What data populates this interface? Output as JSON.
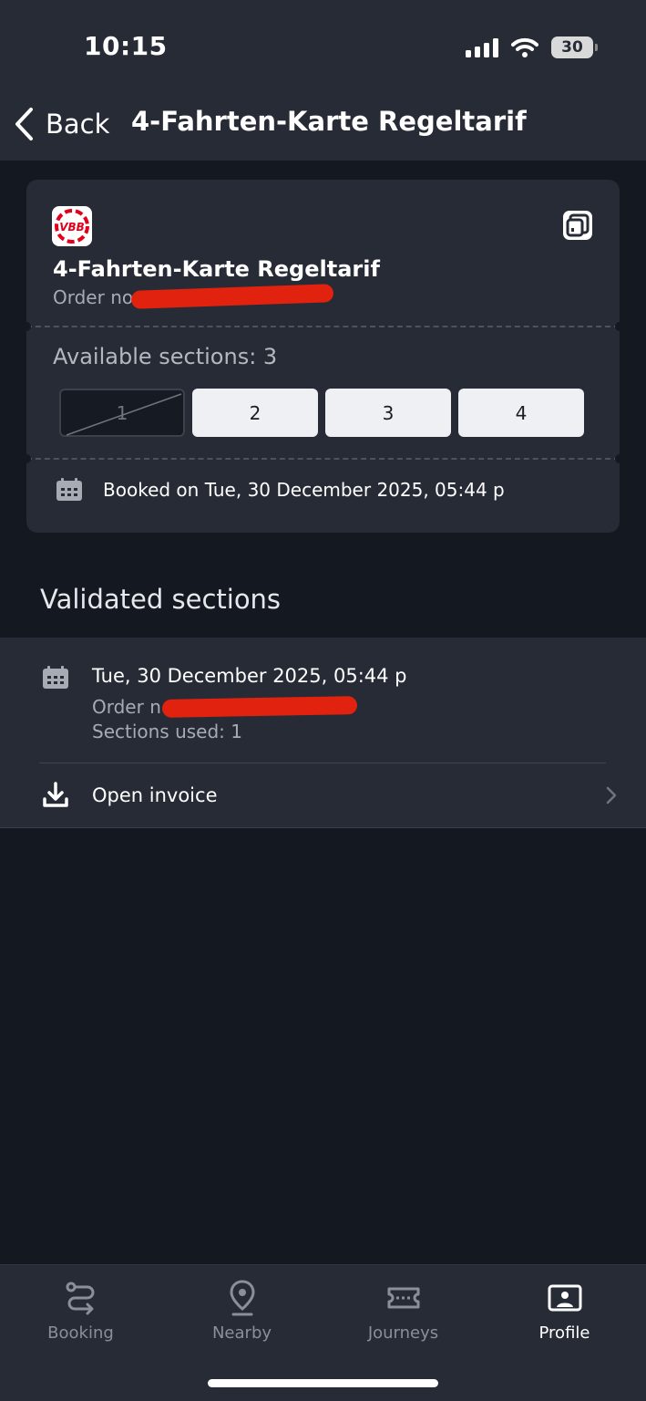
{
  "status_bar": {
    "time": "10:15",
    "battery": "30"
  },
  "nav": {
    "back_label": "Back",
    "title": "4-Fahrten-Karte Regeltarif"
  },
  "ticket": {
    "logo_text": "VBB",
    "title": "4-Fahrten-Karte Regeltarif",
    "order_label": "Order no",
    "available_sections": "Available sections: 3",
    "sections": [
      {
        "label": "1",
        "used": true
      },
      {
        "label": "2",
        "used": false
      },
      {
        "label": "3",
        "used": false
      },
      {
        "label": "4",
        "used": false
      }
    ],
    "booked_on": "Booked on Tue, 30 December 2025, 05:44 p"
  },
  "validated": {
    "heading": "Validated sections",
    "date": "Tue, 30 December 2025, 05:44 p",
    "order_label": "Order n",
    "sections_used": "Sections used: 1",
    "invoice_label": "Open invoice"
  },
  "tabbar": {
    "items": [
      {
        "label": "Booking",
        "icon": "route-icon",
        "active": false
      },
      {
        "label": "Nearby",
        "icon": "location-pin-icon",
        "active": false
      },
      {
        "label": "Journeys",
        "icon": "ticket-icon",
        "active": false
      },
      {
        "label": "Profile",
        "icon": "profile-card-icon",
        "active": true
      }
    ]
  },
  "colors": {
    "redaction": "#e0220e",
    "brand_red": "#e3001b",
    "background": "#141821",
    "surface": "#262b36"
  }
}
